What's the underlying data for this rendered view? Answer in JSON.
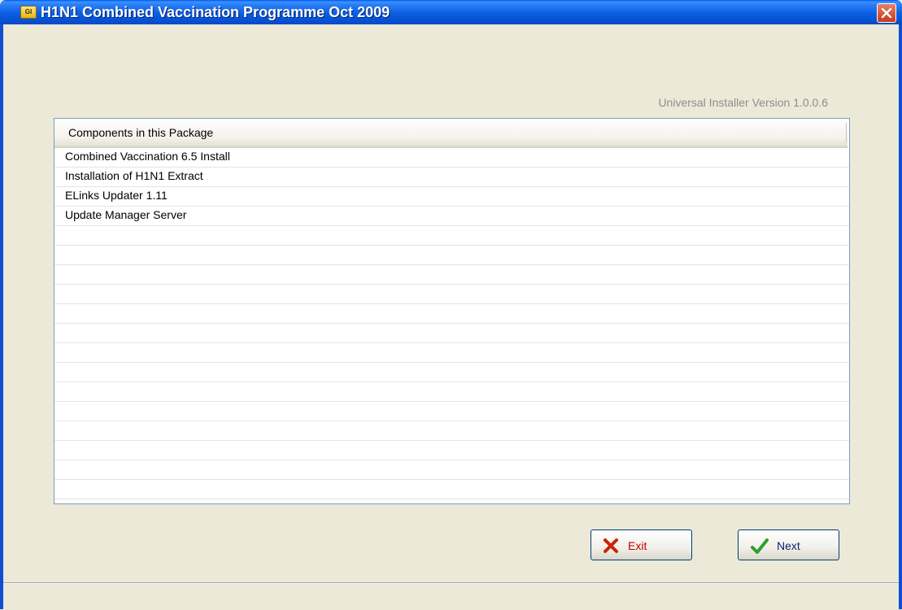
{
  "window": {
    "title": "H1N1 Combined Vaccination Programme Oct 2009",
    "icon_label": "GI",
    "icon": "app-icon",
    "close_icon": "close-icon"
  },
  "version_text": "Universal Installer Version 1.0.0.6",
  "components": {
    "header": "Components in this Package",
    "items": [
      "Combined Vaccination 6.5 Install",
      "Installation of H1N1 Extract",
      "ELinks Updater 1.11",
      "Update Manager Server"
    ]
  },
  "buttons": {
    "exit": {
      "label": "Exit",
      "icon": "x-icon",
      "color": "#C00000"
    },
    "next": {
      "label": "Next",
      "icon": "checkmark-icon",
      "color": "#0A246A"
    }
  },
  "colors": {
    "titlebar": "#0A5FE0",
    "window_bg": "#ECE9D8",
    "exit_icon": "#CC2200",
    "next_icon": "#2E9E2E"
  }
}
